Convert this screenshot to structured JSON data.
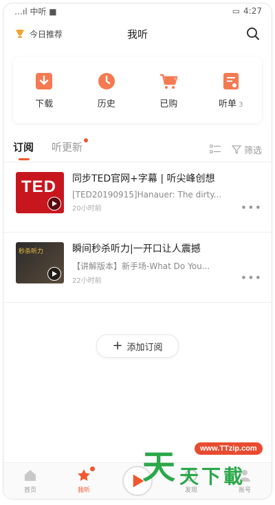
{
  "status_bar": {
    "left": "…ıl 中听 ■",
    "right": "4:27"
  },
  "header": {
    "daily_label": "今日推荐",
    "title": "我听"
  },
  "shortcuts": [
    {
      "icon": "download-icon",
      "label": "下载",
      "count": ""
    },
    {
      "icon": "history-icon",
      "label": "历史",
      "count": ""
    },
    {
      "icon": "cart-icon",
      "label": "已购",
      "count": ""
    },
    {
      "icon": "playlist-icon",
      "label": "听单",
      "count": "3"
    }
  ],
  "tabs": {
    "subscribe": "订阅",
    "updates": "听更新",
    "filter": "筛选"
  },
  "items": [
    {
      "title": "同步TED官网+字幕 | 听尖峰创想",
      "subtitle": "[TED20190915]Hanauer: The dirty...",
      "time": "20小时前",
      "thumb_text": "TED"
    },
    {
      "title": "瞬间秒杀听力|一开口让人震撼",
      "subtitle": "【讲解版本】新手场-What Do You...",
      "time": "22小时前",
      "thumb_text": "秒杀听力"
    }
  ],
  "add_button": "添加订阅",
  "bottom_nav": [
    {
      "label": "首页",
      "icon": "home-icon"
    },
    {
      "label": "我听",
      "icon": "star-icon"
    },
    {
      "label": "",
      "icon": "play-center-icon"
    },
    {
      "label": "发现",
      "icon": "discover-icon"
    },
    {
      "label": "账号",
      "icon": "account-icon"
    }
  ],
  "watermark": {
    "url": "www.TTzip.com",
    "big": "天",
    "small": "天下載"
  },
  "colors": {
    "accent": "#f0572f",
    "ted_red": "#c8161e",
    "watermark_green": "#2ba84a"
  }
}
